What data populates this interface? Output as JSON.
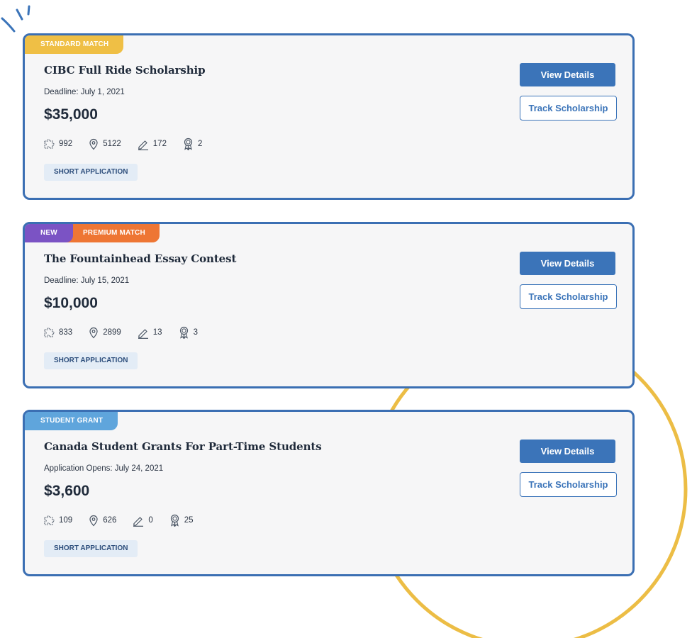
{
  "colors": {
    "card_border": "#3b6fb3",
    "card_bg": "#f6f6f7",
    "primary_button": "#3b74b9",
    "badge_standard": "#efbf45",
    "badge_new": "#7b53c4",
    "badge_premium": "#ee7634",
    "badge_grant": "#5fa5dc",
    "deco_circle": "#ecbd45"
  },
  "icons": {
    "applicants": "puzzle-icon",
    "location": "location-pin-icon",
    "essays": "pencil-icon",
    "awards": "award-ribbon-icon"
  },
  "scholarships": [
    {
      "badges": [
        "STANDARD MATCH"
      ],
      "title": "CIBC Full Ride Scholarship",
      "deadline": "Deadline: July 1, 2021",
      "amount": "$35,000",
      "stats": {
        "applicants": "992",
        "location": "5122",
        "essays": "172",
        "awards": "2"
      },
      "tag": "SHORT APPLICATION",
      "view_label": "View Details",
      "track_label": "Track Scholarship"
    },
    {
      "badges": [
        "NEW",
        "PREMIUM MATCH"
      ],
      "title": "The Fountainhead Essay Contest",
      "deadline": "Deadline: July 15, 2021",
      "amount": "$10,000",
      "stats": {
        "applicants": "833",
        "location": "2899",
        "essays": "13",
        "awards": "3"
      },
      "tag": "SHORT APPLICATION",
      "view_label": "View Details",
      "track_label": "Track Scholarship"
    },
    {
      "badges": [
        "STUDENT GRANT"
      ],
      "title": "Canada Student Grants For Part-Time Students",
      "deadline": "Application Opens: July 24, 2021",
      "amount": "$3,600",
      "stats": {
        "applicants": "109",
        "location": "626",
        "essays": "0",
        "awards": "25"
      },
      "tag": "SHORT APPLICATION",
      "view_label": "View Details",
      "track_label": "Track Scholarship"
    }
  ]
}
